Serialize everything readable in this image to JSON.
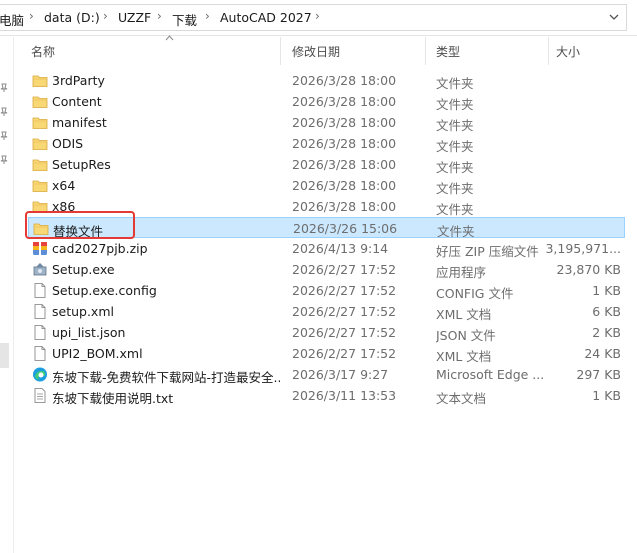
{
  "address": {
    "segments": [
      "电脑",
      "data (D:)",
      "UZZF",
      "下载",
      "AutoCAD 2027"
    ],
    "separator": "›"
  },
  "columns": {
    "name": "名称",
    "date": "修改日期",
    "type": "类型",
    "size": "大小"
  },
  "files": [
    {
      "name": "3rdParty",
      "date": "2026/3/28 18:00",
      "type": "文件夹",
      "size": "",
      "icon": "folder-icon"
    },
    {
      "name": "Content",
      "date": "2026/3/28 18:00",
      "type": "文件夹",
      "size": "",
      "icon": "folder-icon"
    },
    {
      "name": "manifest",
      "date": "2026/3/28 18:00",
      "type": "文件夹",
      "size": "",
      "icon": "folder-icon"
    },
    {
      "name": "ODIS",
      "date": "2026/3/28 18:00",
      "type": "文件夹",
      "size": "",
      "icon": "folder-icon"
    },
    {
      "name": "SetupRes",
      "date": "2026/3/28 18:00",
      "type": "文件夹",
      "size": "",
      "icon": "folder-icon"
    },
    {
      "name": "x64",
      "date": "2026/3/28 18:00",
      "type": "文件夹",
      "size": "",
      "icon": "folder-icon"
    },
    {
      "name": "x86",
      "date": "2026/3/28 18:00",
      "type": "文件夹",
      "size": "",
      "icon": "folder-icon"
    },
    {
      "name": "替换文件",
      "date": "2026/3/26 15:06",
      "type": "文件夹",
      "size": "",
      "icon": "folder-icon",
      "selected": true
    },
    {
      "name": "cad2027pjb.zip",
      "date": "2026/4/13 9:14",
      "type": "好压 ZIP 压缩文件",
      "size": "3,195,971...",
      "icon": "zip-archive-icon"
    },
    {
      "name": "Setup.exe",
      "date": "2026/2/27 17:52",
      "type": "应用程序",
      "size": "23,870 KB",
      "icon": "setup-exe-icon"
    },
    {
      "name": "Setup.exe.config",
      "date": "2026/2/27 17:52",
      "type": "CONFIG 文件",
      "size": "1 KB",
      "icon": "document-icon"
    },
    {
      "name": "setup.xml",
      "date": "2026/2/27 17:52",
      "type": "XML 文档",
      "size": "6 KB",
      "icon": "document-icon"
    },
    {
      "name": "upi_list.json",
      "date": "2026/2/27 17:52",
      "type": "JSON 文件",
      "size": "2 KB",
      "icon": "document-icon"
    },
    {
      "name": "UPI2_BOM.xml",
      "date": "2026/2/27 17:52",
      "type": "XML 文档",
      "size": "24 KB",
      "icon": "document-icon"
    },
    {
      "name": "东坡下载-免费软件下载网站-打造最安全...",
      "date": "2026/3/17 9:27",
      "type": "Microsoft Edge ...",
      "size": "297 KB",
      "icon": "edge-browser-icon"
    },
    {
      "name": "东坡下载使用说明.txt",
      "date": "2026/3/11 13:53",
      "type": "文本文档",
      "size": "1 KB",
      "icon": "text-file-icon"
    }
  ],
  "colors": {
    "selection_bg": "#cce8ff",
    "selection_border": "#99d1ff",
    "folder": "#f8d775",
    "annotation": "#e53935"
  }
}
